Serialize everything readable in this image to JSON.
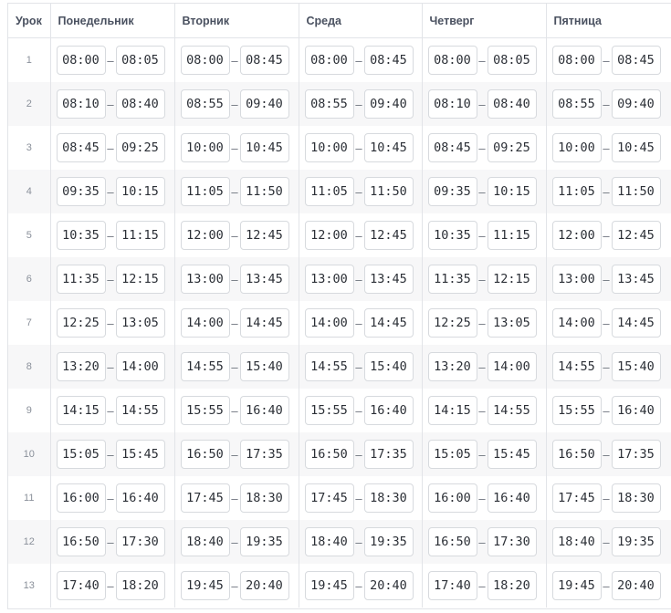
{
  "header": {
    "lesson": "Урок",
    "days": [
      "Понедельник",
      "Вторник",
      "Среда",
      "Четверг",
      "Пятница"
    ]
  },
  "dash": "–",
  "rows": [
    {
      "n": "1",
      "mon": [
        "08:00",
        "08:05"
      ],
      "tue": [
        "08:00",
        "08:45"
      ],
      "wed": [
        "08:00",
        "08:45"
      ],
      "thu": [
        "08:00",
        "08:05"
      ],
      "fri": [
        "08:00",
        "08:45"
      ]
    },
    {
      "n": "2",
      "mon": [
        "08:10",
        "08:40"
      ],
      "tue": [
        "08:55",
        "09:40"
      ],
      "wed": [
        "08:55",
        "09:40"
      ],
      "thu": [
        "08:10",
        "08:40"
      ],
      "fri": [
        "08:55",
        "09:40"
      ]
    },
    {
      "n": "3",
      "mon": [
        "08:45",
        "09:25"
      ],
      "tue": [
        "10:00",
        "10:45"
      ],
      "wed": [
        "10:00",
        "10:45"
      ],
      "thu": [
        "08:45",
        "09:25"
      ],
      "fri": [
        "10:00",
        "10:45"
      ]
    },
    {
      "n": "4",
      "mon": [
        "09:35",
        "10:15"
      ],
      "tue": [
        "11:05",
        "11:50"
      ],
      "wed": [
        "11:05",
        "11:50"
      ],
      "thu": [
        "09:35",
        "10:15"
      ],
      "fri": [
        "11:05",
        "11:50"
      ]
    },
    {
      "n": "5",
      "mon": [
        "10:35",
        "11:15"
      ],
      "tue": [
        "12:00",
        "12:45"
      ],
      "wed": [
        "12:00",
        "12:45"
      ],
      "thu": [
        "10:35",
        "11:15"
      ],
      "fri": [
        "12:00",
        "12:45"
      ]
    },
    {
      "n": "6",
      "mon": [
        "11:35",
        "12:15"
      ],
      "tue": [
        "13:00",
        "13:45"
      ],
      "wed": [
        "13:00",
        "13:45"
      ],
      "thu": [
        "11:35",
        "12:15"
      ],
      "fri": [
        "13:00",
        "13:45"
      ]
    },
    {
      "n": "7",
      "mon": [
        "12:25",
        "13:05"
      ],
      "tue": [
        "14:00",
        "14:45"
      ],
      "wed": [
        "14:00",
        "14:45"
      ],
      "thu": [
        "12:25",
        "13:05"
      ],
      "fri": [
        "14:00",
        "14:45"
      ]
    },
    {
      "n": "8",
      "mon": [
        "13:20",
        "14:00"
      ],
      "tue": [
        "14:55",
        "15:40"
      ],
      "wed": [
        "14:55",
        "15:40"
      ],
      "thu": [
        "13:20",
        "14:00"
      ],
      "fri": [
        "14:55",
        "15:40"
      ]
    },
    {
      "n": "9",
      "mon": [
        "14:15",
        "14:55"
      ],
      "tue": [
        "15:55",
        "16:40"
      ],
      "wed": [
        "15:55",
        "16:40"
      ],
      "thu": [
        "14:15",
        "14:55"
      ],
      "fri": [
        "15:55",
        "16:40"
      ]
    },
    {
      "n": "10",
      "mon": [
        "15:05",
        "15:45"
      ],
      "tue": [
        "16:50",
        "17:35"
      ],
      "wed": [
        "16:50",
        "17:35"
      ],
      "thu": [
        "15:05",
        "15:45"
      ],
      "fri": [
        "16:50",
        "17:35"
      ]
    },
    {
      "n": "11",
      "mon": [
        "16:00",
        "16:40"
      ],
      "tue": [
        "17:45",
        "18:30"
      ],
      "wed": [
        "17:45",
        "18:30"
      ],
      "thu": [
        "16:00",
        "16:40"
      ],
      "fri": [
        "17:45",
        "18:30"
      ]
    },
    {
      "n": "12",
      "mon": [
        "16:50",
        "17:30"
      ],
      "tue": [
        "18:40",
        "19:35"
      ],
      "wed": [
        "18:40",
        "19:35"
      ],
      "thu": [
        "16:50",
        "17:30"
      ],
      "fri": [
        "18:40",
        "19:35"
      ]
    },
    {
      "n": "13",
      "mon": [
        "17:40",
        "18:20"
      ],
      "tue": [
        "19:45",
        "20:40"
      ],
      "wed": [
        "19:45",
        "20:40"
      ],
      "thu": [
        "17:40",
        "18:20"
      ],
      "fri": [
        "19:45",
        "20:40"
      ]
    }
  ]
}
